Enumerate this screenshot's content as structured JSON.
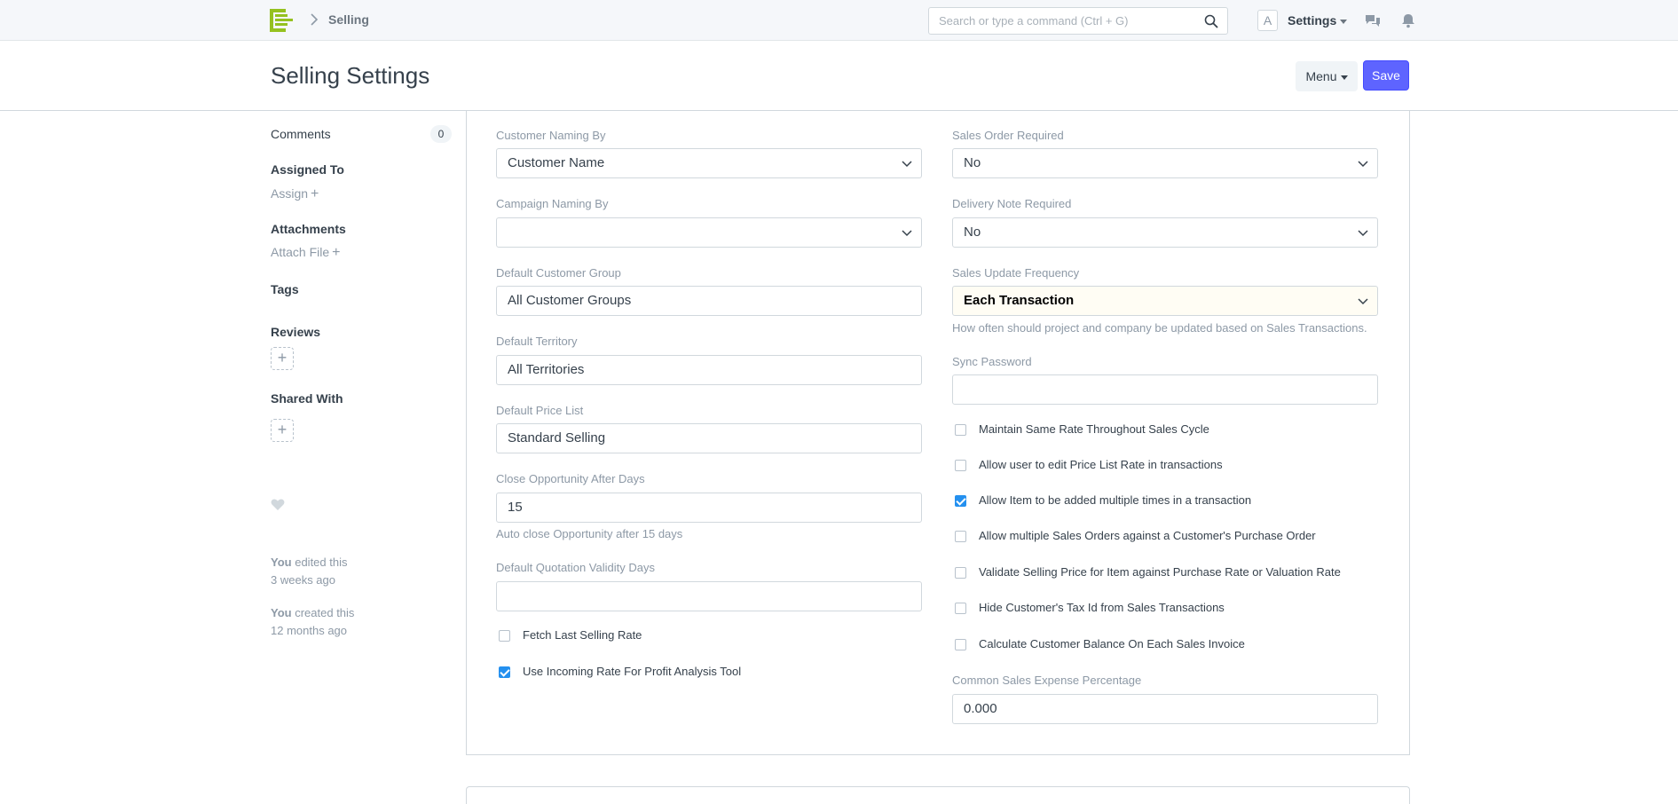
{
  "navbar": {
    "breadcrumb": "Selling",
    "search_placeholder": "Search or type a command (Ctrl + G)",
    "avatar_letter": "A",
    "settings_label": "Settings"
  },
  "header": {
    "title": "Selling Settings",
    "menu_label": "Menu",
    "save_label": "Save"
  },
  "sidebar": {
    "comments_label": "Comments",
    "comments_count": "0",
    "assigned_to": "Assigned To",
    "assign_link": "Assign",
    "attachments": "Attachments",
    "attach_link": "Attach File",
    "tags": "Tags",
    "reviews": "Reviews",
    "shared_with": "Shared With",
    "activity": [
      {
        "who": "You",
        "action": "edited this",
        "when": "3 weeks ago"
      },
      {
        "who": "You",
        "action": "created this",
        "when": "12 months ago"
      }
    ]
  },
  "left_fields": {
    "customer_naming_by": {
      "label": "Customer Naming By",
      "value": "Customer Name"
    },
    "campaign_naming_by": {
      "label": "Campaign Naming By",
      "value": ""
    },
    "default_customer_group": {
      "label": "Default Customer Group",
      "value": "All Customer Groups"
    },
    "default_territory": {
      "label": "Default Territory",
      "value": "All Territories"
    },
    "default_price_list": {
      "label": "Default Price List",
      "value": "Standard Selling"
    },
    "close_opportunity_after_days": {
      "label": "Close Opportunity After Days",
      "value": "15",
      "help": "Auto close Opportunity after 15 days"
    },
    "default_quotation_validity_days": {
      "label": "Default Quotation Validity Days",
      "value": ""
    },
    "fetch_last_selling_rate": {
      "label": "Fetch Last Selling Rate",
      "checked": false
    },
    "use_incoming_rate": {
      "label": "Use Incoming Rate For Profit Analysis Tool",
      "checked": true
    }
  },
  "right_fields": {
    "sales_order_required": {
      "label": "Sales Order Required",
      "value": "No"
    },
    "delivery_note_required": {
      "label": "Delivery Note Required",
      "value": "No"
    },
    "sales_update_frequency": {
      "label": "Sales Update Frequency",
      "value": "Each Transaction",
      "help": "How often should project and company be updated based on Sales Transactions."
    },
    "sync_password": {
      "label": "Sync Password",
      "value": ""
    },
    "checks": [
      {
        "label": "Maintain Same Rate Throughout Sales Cycle",
        "checked": false
      },
      {
        "label": "Allow user to edit Price List Rate in transactions",
        "checked": false
      },
      {
        "label": "Allow Item to be added multiple times in a transaction",
        "checked": true
      },
      {
        "label": "Allow multiple Sales Orders against a Customer's Purchase Order",
        "checked": false
      },
      {
        "label": "Validate Selling Price for Item against Purchase Rate or Valuation Rate",
        "checked": false
      },
      {
        "label": "Hide Customer's Tax Id from Sales Transactions",
        "checked": false
      },
      {
        "label": "Calculate Customer Balance On Each Sales Invoice",
        "checked": false
      }
    ],
    "common_sales_expense_percentage": {
      "label": "Common Sales Expense Percentage",
      "value": "0.000"
    }
  },
  "colors": {
    "primary": "#5e64ff",
    "checkbox": "#2490ef",
    "muted": "#8d99a6",
    "text": "#36414c"
  }
}
